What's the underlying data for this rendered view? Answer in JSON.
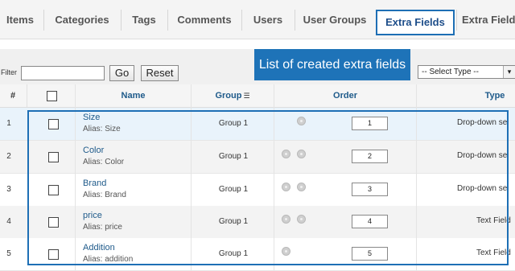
{
  "tabs": [
    {
      "label": "Items"
    },
    {
      "label": "Categories"
    },
    {
      "label": "Tags"
    },
    {
      "label": "Comments"
    },
    {
      "label": "Users"
    },
    {
      "label": "User Groups"
    },
    {
      "label": "Extra Fields"
    },
    {
      "label": "Extra Field"
    }
  ],
  "filter": {
    "label": "Filter",
    "value": "",
    "go": "Go",
    "reset": "Reset"
  },
  "callout": "List of created extra fields",
  "type_select": {
    "selected": "-- Select Type --",
    "arrow": "▾"
  },
  "table": {
    "headers": {
      "num": "#",
      "name": "Name",
      "group": "Group",
      "order": "Order",
      "type": "Type"
    },
    "rows": [
      {
        "num": "1",
        "name": "Size",
        "alias": "Alias: Size",
        "group": "Group 1",
        "order": "1",
        "type": "Drop-down sel"
      },
      {
        "num": "2",
        "name": "Color",
        "alias": "Alias: Color",
        "group": "Group 1",
        "order": "2",
        "type": "Drop-down sel"
      },
      {
        "num": "3",
        "name": "Brand",
        "alias": "Alias: Brand",
        "group": "Group 1",
        "order": "3",
        "type": "Drop-down sel"
      },
      {
        "num": "4",
        "name": "price",
        "alias": "Alias: price",
        "group": "Group 1",
        "order": "4",
        "type": "Text Field"
      },
      {
        "num": "5",
        "name": "Addition",
        "alias": "Alias: addition",
        "group": "Group 1",
        "order": "5",
        "type": "Text Field"
      }
    ]
  },
  "colors": {
    "accent": "#1e6fb5",
    "link": "#1e5a8a"
  },
  "icons": {
    "sort": "sort-icon",
    "order_up": "order-up-icon",
    "order_down": "order-down-icon",
    "select_arrow": "chevron-down-icon"
  }
}
